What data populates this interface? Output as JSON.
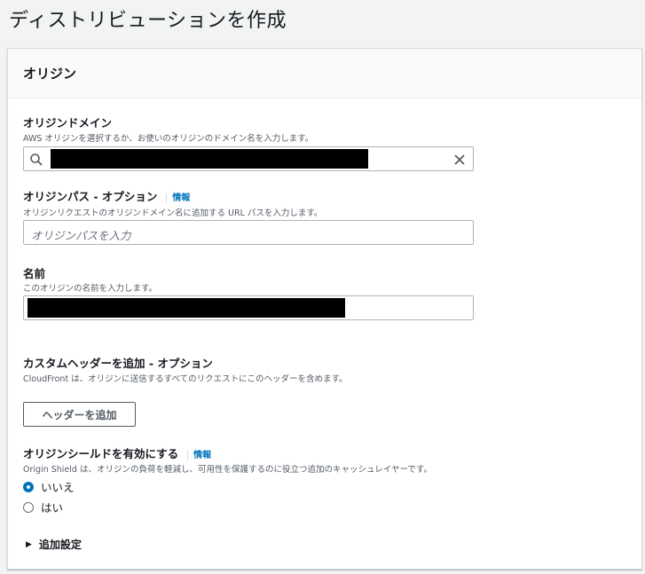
{
  "page": {
    "title": "ディストリビューションを作成"
  },
  "panel": {
    "title": "オリジン"
  },
  "origin_domain": {
    "label": "オリジンドメイン",
    "description": "AWS オリジンを選択するか、お使いのオリジンのドメイン名を入力します。"
  },
  "origin_path": {
    "label": "オリジンパス - オプション",
    "info": "情報",
    "description": "オリジンリクエストのオリジンドメイン名に追加する URL パスを入力します。",
    "placeholder": "オリジンパスを入力"
  },
  "name": {
    "label": "名前",
    "description": "このオリジンの名前を入力します。"
  },
  "custom_header": {
    "label": "カスタムヘッダーを追加 - オプション",
    "description": "CloudFront は、オリジンに送信するすべてのリクエストにこのヘッダーを含めます。",
    "button": "ヘッダーを追加"
  },
  "origin_shield": {
    "label": "オリジンシールドを有効にする",
    "info": "情報",
    "description": "Origin Shield は、オリジンの負荷を軽減し、可用性を保護するのに役立つ追加のキャッシュレイヤーです。",
    "options": [
      "いいえ",
      "はい"
    ],
    "selected": "いいえ"
  },
  "additional_settings": {
    "label": "追加設定"
  },
  "colors": {
    "accent": "#0073bb",
    "text": "#16191f",
    "muted": "#545b64"
  }
}
